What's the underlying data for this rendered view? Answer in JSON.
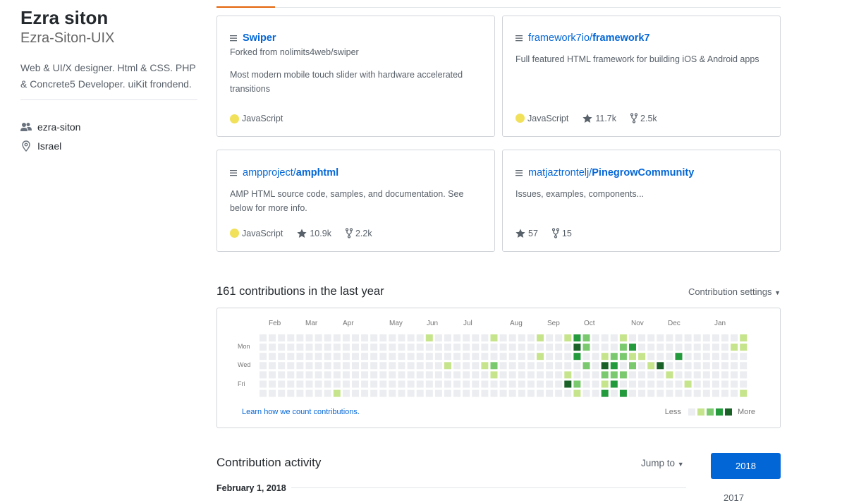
{
  "profile": {
    "name": "Ezra siton",
    "login": "Ezra-Siton-UIX",
    "bio": "Web & UI/X designer. Html & CSS. PHP & Concrete5 Developer. uiKit frondend.",
    "organization": "ezra-siton",
    "location": "Israel"
  },
  "pinned": [
    {
      "owner": "",
      "name": "Swiper",
      "forked_from": "Forked from nolimits4web/swiper",
      "description": "Most modern mobile touch slider with hardware accelerated transitions",
      "language": "JavaScript",
      "stars": "",
      "forks": ""
    },
    {
      "owner": "framework7io/",
      "name": "framework7",
      "forked_from": "",
      "description": "Full featured HTML framework for building iOS & Android apps",
      "language": "JavaScript",
      "stars": "11.7k",
      "forks": "2.5k"
    },
    {
      "owner": "ampproject/",
      "name": "amphtml",
      "forked_from": "",
      "description": "AMP HTML source code, samples, and documentation. See below for more info.",
      "language": "JavaScript",
      "stars": "10.9k",
      "forks": "2.2k"
    },
    {
      "owner": "matjaztrontelj/",
      "name": "PinegrowCommunity",
      "forked_from": "",
      "description": "Issues, examples, components...",
      "language": "",
      "stars": "57",
      "forks": "15"
    }
  ],
  "contributions": {
    "heading": "161 contributions in the last year",
    "settings_label": "Contribution settings",
    "months": [
      "Feb",
      "Mar",
      "Apr",
      "May",
      "Jun",
      "Jul",
      "Aug",
      "Sep",
      "Oct",
      "Nov",
      "Dec",
      "Jan"
    ],
    "days": [
      "Mon",
      "Wed",
      "Fri"
    ],
    "learn_link": "Learn how we count contributions.",
    "legend_less": "Less",
    "legend_more": "More",
    "colors": [
      "#ebedf0",
      "#c6e48b",
      "#7bc96f",
      "#239a3b",
      "#196127"
    ],
    "levels": [
      {
        "week": 18,
        "day": 0,
        "level": 1
      },
      {
        "week": 25,
        "day": 0,
        "level": 1
      },
      {
        "week": 30,
        "day": 0,
        "level": 1
      },
      {
        "week": 33,
        "day": 0,
        "level": 1
      },
      {
        "week": 34,
        "day": 0,
        "level": 3
      },
      {
        "week": 35,
        "day": 0,
        "level": 2
      },
      {
        "week": 39,
        "day": 0,
        "level": 1
      },
      {
        "week": 52,
        "day": 0,
        "level": 1
      },
      {
        "week": 34,
        "day": 1,
        "level": 4
      },
      {
        "week": 35,
        "day": 1,
        "level": 2
      },
      {
        "week": 39,
        "day": 1,
        "level": 2
      },
      {
        "week": 40,
        "day": 1,
        "level": 3
      },
      {
        "week": 51,
        "day": 1,
        "level": 1
      },
      {
        "week": 52,
        "day": 1,
        "level": 1
      },
      {
        "week": 30,
        "day": 2,
        "level": 1
      },
      {
        "week": 34,
        "day": 2,
        "level": 3
      },
      {
        "week": 37,
        "day": 2,
        "level": 1
      },
      {
        "week": 38,
        "day": 2,
        "level": 2
      },
      {
        "week": 39,
        "day": 2,
        "level": 2
      },
      {
        "week": 40,
        "day": 2,
        "level": 1
      },
      {
        "week": 41,
        "day": 2,
        "level": 1
      },
      {
        "week": 45,
        "day": 2,
        "level": 3
      },
      {
        "week": 20,
        "day": 3,
        "level": 1
      },
      {
        "week": 24,
        "day": 3,
        "level": 1
      },
      {
        "week": 25,
        "day": 3,
        "level": 2
      },
      {
        "week": 35,
        "day": 3,
        "level": 2
      },
      {
        "week": 37,
        "day": 3,
        "level": 4
      },
      {
        "week": 38,
        "day": 3,
        "level": 3
      },
      {
        "week": 40,
        "day": 3,
        "level": 2
      },
      {
        "week": 42,
        "day": 3,
        "level": 1
      },
      {
        "week": 43,
        "day": 3,
        "level": 4
      },
      {
        "week": 25,
        "day": 4,
        "level": 1
      },
      {
        "week": 33,
        "day": 4,
        "level": 1
      },
      {
        "week": 37,
        "day": 4,
        "level": 2
      },
      {
        "week": 38,
        "day": 4,
        "level": 2
      },
      {
        "week": 39,
        "day": 4,
        "level": 2
      },
      {
        "week": 44,
        "day": 4,
        "level": 1
      },
      {
        "week": 33,
        "day": 5,
        "level": 4
      },
      {
        "week": 34,
        "day": 5,
        "level": 2
      },
      {
        "week": 37,
        "day": 5,
        "level": 1
      },
      {
        "week": 38,
        "day": 5,
        "level": 3
      },
      {
        "week": 46,
        "day": 5,
        "level": 1
      },
      {
        "week": 8,
        "day": 6,
        "level": 1
      },
      {
        "week": 34,
        "day": 6,
        "level": 1
      },
      {
        "week": 37,
        "day": 6,
        "level": 3
      },
      {
        "week": 39,
        "day": 6,
        "level": 3
      },
      {
        "week": 52,
        "day": 6,
        "level": 1
      }
    ]
  },
  "activity": {
    "heading": "Contribution activity",
    "jump_to": "Jump to",
    "date_heading": "February 1, 2018",
    "years": [
      "2018",
      "2017"
    ]
  }
}
